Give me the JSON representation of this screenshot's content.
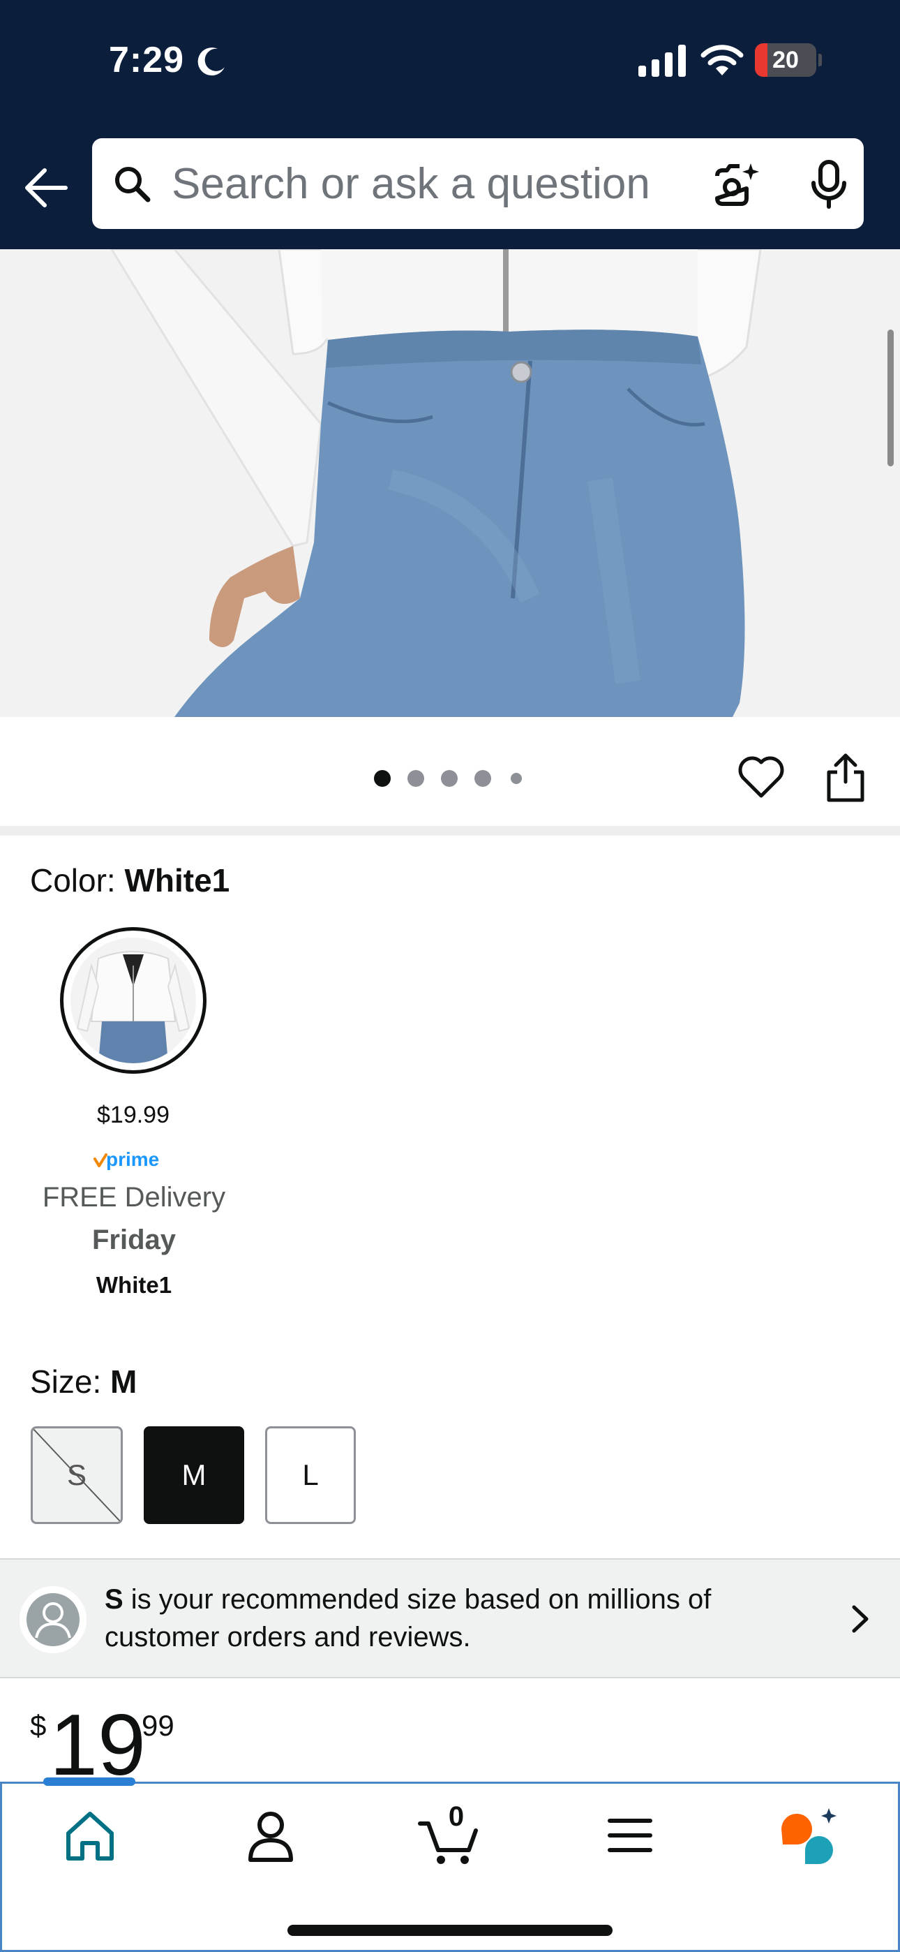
{
  "status_bar": {
    "time": "7:29",
    "battery": "20",
    "battery_level_percent": 20
  },
  "search": {
    "placeholder": "Search or ask a question"
  },
  "gallery": {
    "image_count": 5,
    "active_index": 0
  },
  "color": {
    "label": "Color: ",
    "value": "White1",
    "swatch": {
      "price": "$19.99",
      "prime": "prime",
      "delivery": "FREE Delivery",
      "day": "Friday",
      "name": "White1"
    }
  },
  "size": {
    "label": "Size: ",
    "value": "M",
    "options": [
      {
        "label": "S",
        "state": "unavailable"
      },
      {
        "label": "M",
        "state": "selected"
      },
      {
        "label": "L",
        "state": "available"
      }
    ]
  },
  "recommendation": {
    "size": "S",
    "text": " is your recommended size based on millions of customer orders and reviews."
  },
  "price": {
    "symbol": "$",
    "whole": "19",
    "fraction": "99"
  },
  "nav": {
    "items": [
      "home-icon",
      "account-icon",
      "cart-icon",
      "menu-icon",
      "rufus-icon"
    ],
    "cart_count": "0",
    "active": "home-icon"
  },
  "colors": {
    "header_bg": "#0b1f3d",
    "nav_active": "#007185",
    "rufus_orange": "#ff6200",
    "rufus_teal": "#1da1b8"
  }
}
